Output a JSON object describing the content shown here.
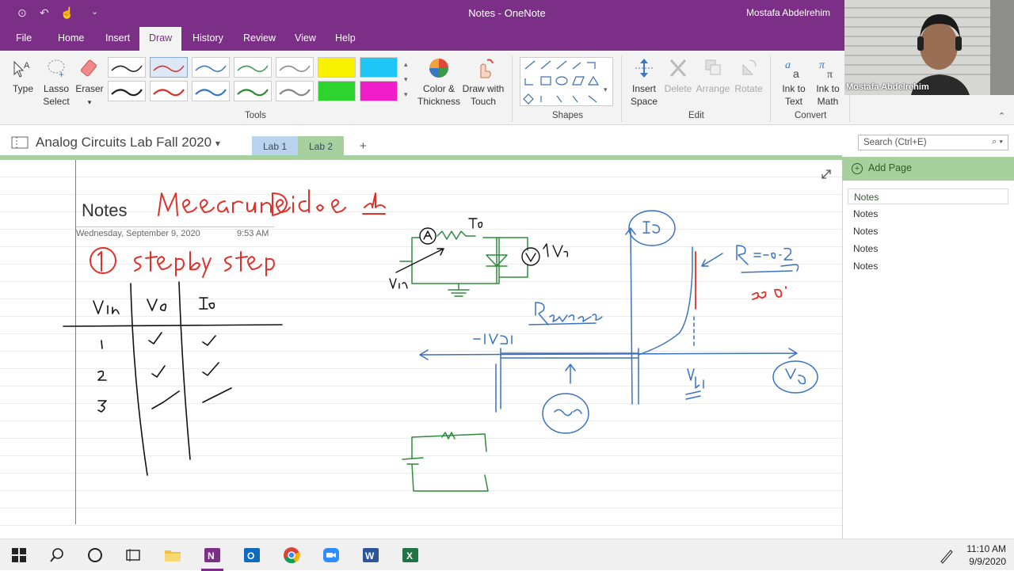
{
  "window": {
    "title": "Notes - OneNote",
    "user": "Mostafa Abdelrehim"
  },
  "ribbon_tabs": [
    "File",
    "Home",
    "Insert",
    "Draw",
    "History",
    "Review",
    "View",
    "Help"
  ],
  "active_tab": "Draw",
  "ribbon": {
    "type": "Type",
    "lasso_1": "Lasso",
    "lasso_2": "Select",
    "eraser": "Eraser",
    "color_1": "Color &",
    "color_2": "Thickness",
    "drawtouch_1": "Draw with",
    "drawtouch_2": "Touch",
    "insert_1": "Insert",
    "insert_2": "Space",
    "delete": "Delete",
    "arrange": "Arrange",
    "rotate": "Rotate",
    "inktext_1": "Ink to",
    "inktext_2": "Text",
    "inkmath_1": "Ink to",
    "inkmath_2": "Math",
    "groups": {
      "tools": "Tools",
      "shapes": "Shapes",
      "edit": "Edit",
      "convert": "Convert"
    },
    "pens": [
      "#222222",
      "#d9302f",
      "#3a78c3",
      "#3a9a4a",
      "#888888",
      "#222222",
      "#d9302f",
      "#3a78c3",
      "#2f8a3a",
      "#888888"
    ],
    "highlighters": [
      "#f8f200",
      "#1ec6f5",
      "#2ed42e",
      "#f01ec8"
    ]
  },
  "notebook": {
    "name": "Analog Circuits Lab Fall 2020",
    "sections": [
      "Lab 1",
      "Lab 2",
      "+"
    ],
    "active_section": "Lab 2"
  },
  "search": {
    "placeholder": "Search (Ctrl+E)"
  },
  "page": {
    "title": "Notes",
    "date": "Wednesday, September 9, 2020",
    "time": "9:53 AM"
  },
  "pages_pane": {
    "add_page": "Add Page",
    "pages": [
      "Notes",
      "Notes",
      "Notes",
      "Notes",
      "Notes"
    ]
  },
  "webcam": {
    "label": "Mostafa Abdelrehim"
  },
  "taskbar": {
    "time": "11:10 AM",
    "date": "9/9/2020",
    "apps": [
      "start",
      "search",
      "cortana",
      "task-view",
      "file-explorer",
      "onenote",
      "outlook",
      "chrome",
      "zoom",
      "word",
      "excel"
    ]
  }
}
